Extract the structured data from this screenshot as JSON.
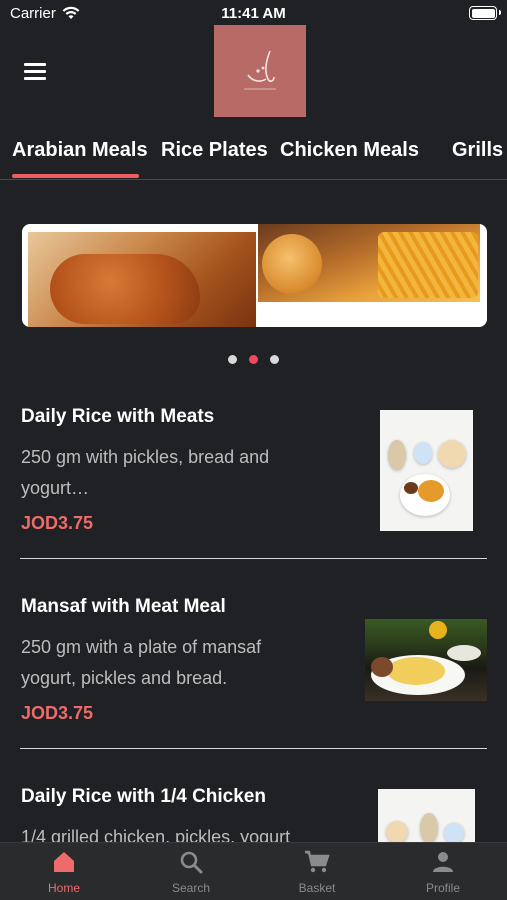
{
  "status_bar": {
    "carrier": "Carrier",
    "time": "11:41 AM"
  },
  "tabs": [
    {
      "label": "Arabian Meals",
      "active": true
    },
    {
      "label": "Rice Plates",
      "active": false
    },
    {
      "label": "Chicken Meals",
      "active": false
    },
    {
      "label": "Grills",
      "active": false
    }
  ],
  "banner": {
    "current_slide": 2,
    "slide_count": 3
  },
  "menu_items": [
    {
      "title": "Daily Rice with Meats",
      "description": "250 gm with pickles, bread and yogurt…",
      "price": "JOD3.75"
    },
    {
      "title": "Mansaf with Meat Meal",
      "description": "250 gm with a plate of mansaf yogurt, pickles and bread.",
      "price": "JOD3.75"
    },
    {
      "title": "Daily Rice with 1/4 Chicken",
      "description": "1/4 grilled chicken, pickles, yogurt",
      "price": ""
    }
  ],
  "tabbar": [
    {
      "label": "Home",
      "icon": "home-icon",
      "active": true
    },
    {
      "label": "Search",
      "icon": "search-icon",
      "active": false
    },
    {
      "label": "Basket",
      "icon": "cart-icon",
      "active": false
    },
    {
      "label": "Profile",
      "icon": "profile-icon",
      "active": false
    }
  ],
  "colors": {
    "accent": "#ee5e5e",
    "background": "#202124",
    "price": "#ee6b6b"
  }
}
